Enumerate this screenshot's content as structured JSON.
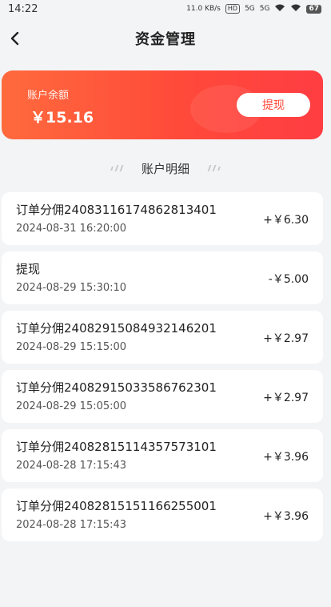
{
  "status_bar": {
    "time": "14:22",
    "net_speed": "11.0 KB/s",
    "hd_label": "HD",
    "signal1": "5G",
    "signal2": "5G",
    "battery": "67"
  },
  "header": {
    "back_icon": "chevron-left-icon",
    "title": "资金管理"
  },
  "balance": {
    "label": "账户余额",
    "amount": "￥15.16",
    "withdraw_label": "提现",
    "colors": {
      "gradient_start": "#ff6a3d",
      "gradient_end": "#ff3d42"
    }
  },
  "section": {
    "title": "账户明细"
  },
  "records": [
    {
      "title": "订单分佣24083116174862813401",
      "time": "2024-08-31 16:20:00",
      "amount": "+￥6.30"
    },
    {
      "title": "提现",
      "time": "2024-08-29 15:30:10",
      "amount": "-￥5.00"
    },
    {
      "title": "订单分佣24082915084932146201",
      "time": "2024-08-29 15:15:00",
      "amount": "+￥2.97"
    },
    {
      "title": "订单分佣24082915033586762301",
      "time": "2024-08-29 15:05:00",
      "amount": "+￥2.97"
    },
    {
      "title": "订单分佣24082815114357573101",
      "time": "2024-08-28 17:15:43",
      "amount": "+￥3.96"
    },
    {
      "title": "订单分佣24082815151166255001",
      "time": "2024-08-28 17:15:43",
      "amount": "+￥3.96"
    }
  ]
}
